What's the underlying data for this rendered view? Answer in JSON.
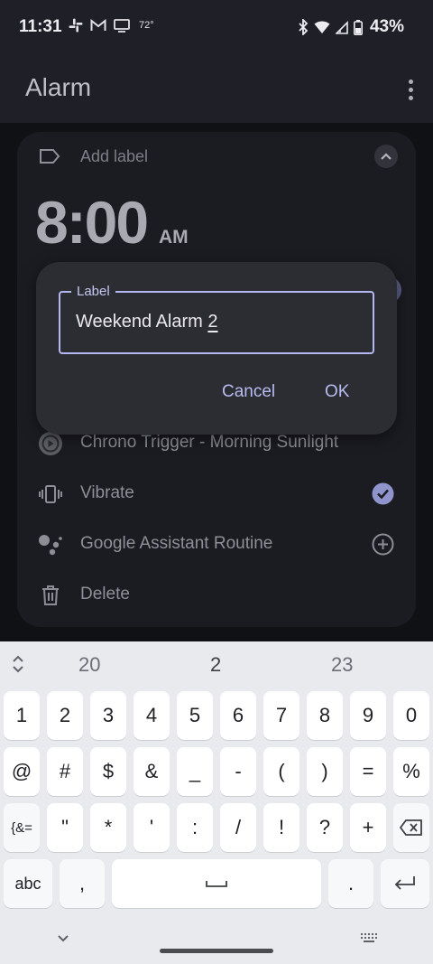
{
  "status_bar": {
    "time": "11:31",
    "temperature": "72°",
    "battery": "43%",
    "left_icons": [
      "slack-icon",
      "gmail-icon",
      "cast-icon"
    ],
    "right_icons": [
      "bluetooth-icon",
      "wifi-icon",
      "cell-signal-icon",
      "battery-icon"
    ]
  },
  "app_bar": {
    "title": "Alarm"
  },
  "alarm": {
    "add_label": "Add label",
    "time": "8:00",
    "ampm": "AM",
    "rows": [
      {
        "icon": "play-circle-icon",
        "text": "Chrono Trigger - Morning Sunlight"
      },
      {
        "icon": "vibrate-icon",
        "text": "Vibrate",
        "checked": true
      },
      {
        "icon": "google-assistant-icon",
        "text": "Google Assistant Routine"
      },
      {
        "icon": "delete-icon",
        "text": "Delete"
      }
    ]
  },
  "dialog": {
    "field_label": "Label",
    "value_prefix": "Weekend Alarm ",
    "value_composing": "2",
    "cancel": "Cancel",
    "ok": "OK"
  },
  "keyboard": {
    "suggestions": [
      "20",
      "2",
      "23"
    ],
    "row1": [
      "1",
      "2",
      "3",
      "4",
      "5",
      "6",
      "7",
      "8",
      "9",
      "0"
    ],
    "row2": [
      "@",
      "#",
      "$",
      "&",
      "_",
      "-",
      "(",
      ")",
      "=",
      "%"
    ],
    "row3_mode": "{&=",
    "row3": [
      "\"",
      "*",
      "'",
      ":",
      "/",
      "!",
      "?",
      "+"
    ],
    "abc": "abc",
    "comma": ",",
    "period": "."
  },
  "colors": {
    "accent": "#b9bbf0",
    "check": "#9094cc",
    "dialog": "#2c2d33",
    "keyboard": "#e8eaee"
  }
}
